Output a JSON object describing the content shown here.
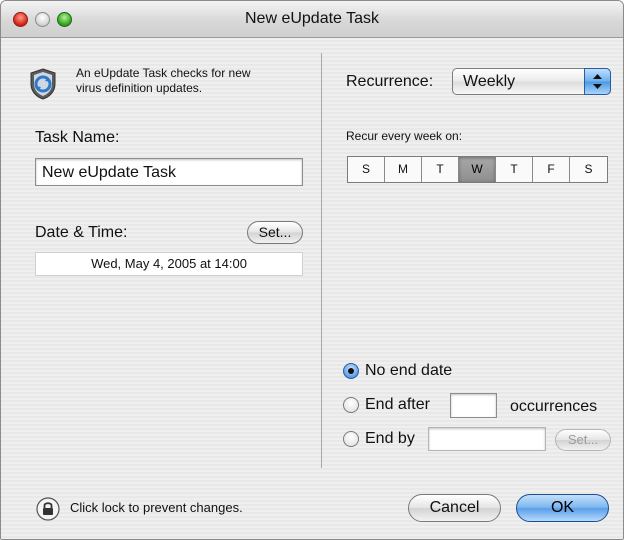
{
  "window": {
    "title": "New eUpdate Task"
  },
  "info": {
    "text_line1": "An eUpdate Task checks for new",
    "text_line2": "virus definition updates."
  },
  "task_name": {
    "label": "Task Name:",
    "value": "New eUpdate Task"
  },
  "date_time": {
    "label": "Date & Time:",
    "set_label": "Set...",
    "value": "Wed, May 4, 2005 at 14:00"
  },
  "recurrence": {
    "label": "Recurrence:",
    "selected": "Weekly",
    "recur_label": "Recur every week on:",
    "days": [
      {
        "label": "S",
        "selected": false
      },
      {
        "label": "M",
        "selected": false
      },
      {
        "label": "T",
        "selected": false
      },
      {
        "label": "W",
        "selected": true
      },
      {
        "label": "T",
        "selected": false
      },
      {
        "label": "F",
        "selected": false
      },
      {
        "label": "S",
        "selected": false
      }
    ]
  },
  "end": {
    "no_end_label": "No end date",
    "end_after_label": "End after",
    "occurrences_label": "occurrences",
    "occurrences_value": "",
    "end_by_label": "End by",
    "end_by_value": "",
    "set_label": "Set...",
    "selected": "no_end_date"
  },
  "footer": {
    "lock_text": "Click lock to prevent changes.",
    "cancel_label": "Cancel",
    "ok_label": "OK"
  }
}
